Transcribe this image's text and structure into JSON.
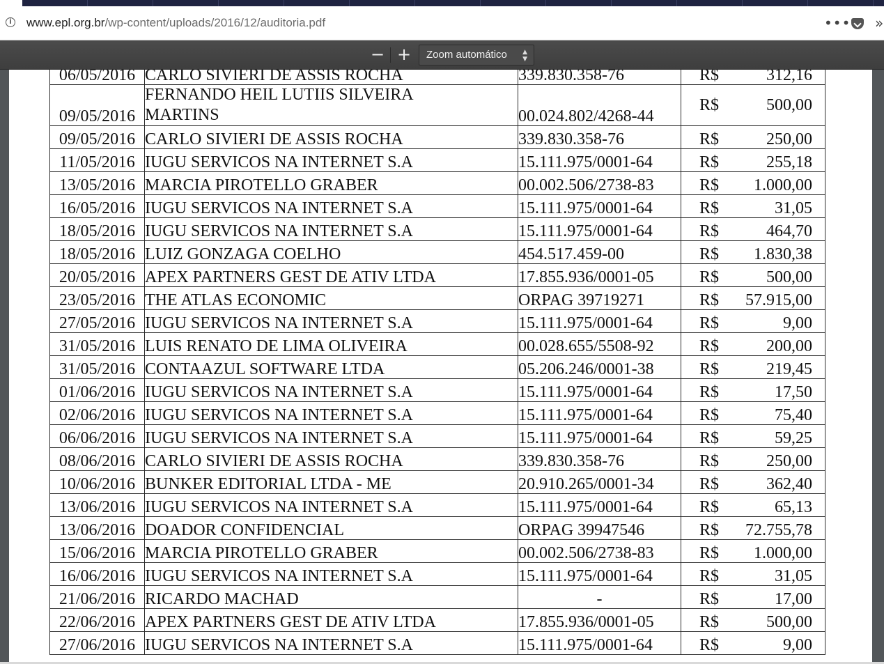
{
  "browser": {
    "url_host": "www.epl.org.br",
    "url_path": "/wp-content/uploads/2016/12/auditoria.pdf",
    "info_glyph": "i",
    "more_glyph": "•••",
    "overflow_glyph": "»"
  },
  "pdf_toolbar": {
    "zoom_out_label": "−",
    "zoom_in_label": "+",
    "zoom_value": "Zoom automático",
    "caret_glyph": "▲▼"
  },
  "ledger": {
    "rows": [
      {
        "date": "06/05/2016",
        "name": "CARLO SIVIERI DE ASSIS ROCHA",
        "doc": "339.830.358-76",
        "currency": "R$",
        "amount": "312,16"
      },
      {
        "date": "09/05/2016",
        "name": "FERNANDO HEIL LUTIIS SILVEIRA MARTINS",
        "doc": "00.024.802/4268-44",
        "currency": "R$",
        "amount": "500,00"
      },
      {
        "date": "09/05/2016",
        "name": "CARLO SIVIERI DE ASSIS ROCHA",
        "doc": "339.830.358-76",
        "currency": "R$",
        "amount": "250,00"
      },
      {
        "date": "11/05/2016",
        "name": "IUGU SERVICOS NA INTERNET S.A",
        "doc": "15.111.975/0001-64",
        "currency": "R$",
        "amount": "255,18"
      },
      {
        "date": "13/05/2016",
        "name": "MARCIA PIROTELLO GRABER",
        "doc": "00.002.506/2738-83",
        "currency": "R$",
        "amount": "1.000,00"
      },
      {
        "date": "16/05/2016",
        "name": "IUGU SERVICOS NA INTERNET S.A",
        "doc": "15.111.975/0001-64",
        "currency": "R$",
        "amount": "31,05"
      },
      {
        "date": "18/05/2016",
        "name": "IUGU SERVICOS NA INTERNET S.A",
        "doc": "15.111.975/0001-64",
        "currency": "R$",
        "amount": "464,70"
      },
      {
        "date": "18/05/2016",
        "name": "LUIZ GONZAGA COELHO",
        "doc": "454.517.459-00",
        "currency": "R$",
        "amount": "1.830,38"
      },
      {
        "date": "20/05/2016",
        "name": "APEX PARTNERS GEST DE ATIV LTDA",
        "doc": "17.855.936/0001-05",
        "currency": "R$",
        "amount": "500,00"
      },
      {
        "date": "23/05/2016",
        "name": "THE ATLAS ECONOMIC",
        "doc": "ORPAG 39719271",
        "currency": "R$",
        "amount": "57.915,00"
      },
      {
        "date": "27/05/2016",
        "name": "IUGU SERVICOS NA INTERNET S.A",
        "doc": "15.111.975/0001-64",
        "currency": "R$",
        "amount": "9,00"
      },
      {
        "date": "31/05/2016",
        "name": "LUIS RENATO DE LIMA OLIVEIRA",
        "doc": "00.028.655/5508-92",
        "currency": "R$",
        "amount": "200,00"
      },
      {
        "date": "31/05/2016",
        "name": "CONTAAZUL SOFTWARE LTDA",
        "doc": "05.206.246/0001-38",
        "currency": "R$",
        "amount": "219,45"
      },
      {
        "date": "01/06/2016",
        "name": "IUGU SERVICOS NA INTERNET S.A",
        "doc": "15.111.975/0001-64",
        "currency": "R$",
        "amount": "17,50"
      },
      {
        "date": "02/06/2016",
        "name": "IUGU SERVICOS NA INTERNET S.A",
        "doc": "15.111.975/0001-64",
        "currency": "R$",
        "amount": "75,40"
      },
      {
        "date": "06/06/2016",
        "name": "IUGU SERVICOS NA INTERNET S.A",
        "doc": "15.111.975/0001-64",
        "currency": "R$",
        "amount": "59,25"
      },
      {
        "date": "08/06/2016",
        "name": "CARLO SIVIERI DE ASSIS ROCHA",
        "doc": "339.830.358-76",
        "currency": "R$",
        "amount": "250,00"
      },
      {
        "date": "10/06/2016",
        "name": "BUNKER EDITORIAL LTDA - ME",
        "doc": "20.910.265/0001-34",
        "currency": "R$",
        "amount": "362,40"
      },
      {
        "date": "13/06/2016",
        "name": "IUGU SERVICOS NA INTERNET S.A",
        "doc": "15.111.975/0001-64",
        "currency": "R$",
        "amount": "65,13"
      },
      {
        "date": "13/06/2016",
        "name": "DOADOR CONFIDENCIAL",
        "doc": "ORPAG 39947546",
        "currency": "R$",
        "amount": "72.755,78"
      },
      {
        "date": "15/06/2016",
        "name": "MARCIA PIROTELLO GRABER",
        "doc": "00.002.506/2738-83",
        "currency": "R$",
        "amount": "1.000,00"
      },
      {
        "date": "16/06/2016",
        "name": "IUGU SERVICOS NA INTERNET S.A",
        "doc": "15.111.975/0001-64",
        "currency": "R$",
        "amount": "31,05"
      },
      {
        "date": "21/06/2016",
        "name": "RICARDO MACHAD",
        "doc": "-",
        "currency": "R$",
        "amount": "17,00"
      },
      {
        "date": "22/06/2016",
        "name": "APEX PARTNERS GEST DE ATIV LTDA",
        "doc": "17.855.936/0001-05",
        "currency": "R$",
        "amount": "500,00"
      },
      {
        "date": "27/06/2016",
        "name": "IUGU SERVICOS NA INTERNET S.A",
        "doc": "15.111.975/0001-64",
        "currency": "R$",
        "amount": "9,00"
      }
    ]
  }
}
